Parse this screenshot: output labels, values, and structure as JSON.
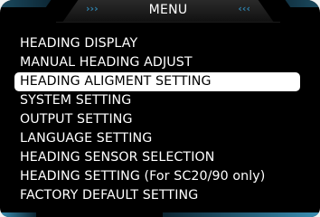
{
  "header": {
    "title": "MENU",
    "chevron_left": "›››",
    "chevron_right": "‹‹‹"
  },
  "menu": {
    "items": [
      {
        "label": "HEADING DISPLAY",
        "selected": false
      },
      {
        "label": "MANUAL HEADING ADJUST",
        "selected": false
      },
      {
        "label": "HEADING ALIGMENT SETTING",
        "selected": true
      },
      {
        "label": "SYSTEM SETTING",
        "selected": false
      },
      {
        "label": "OUTPUT SETTING",
        "selected": false
      },
      {
        "label": "LANGUAGE SETTING",
        "selected": false
      },
      {
        "label": "HEADING SENSOR SELECTION",
        "selected": false
      },
      {
        "label": "HEADING SETTING (For SC20/90 only)",
        "selected": false
      },
      {
        "label": "FACTORY DEFAULT SETTING",
        "selected": false
      }
    ]
  },
  "colors": {
    "background": "#000000",
    "text": "#ffffff",
    "highlight_bg": "#ffffff",
    "highlight_text": "#000000",
    "accent": "#2e7fa8"
  }
}
